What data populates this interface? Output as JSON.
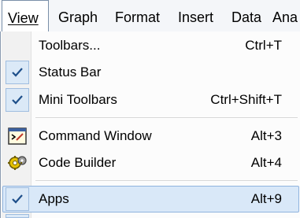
{
  "menubar": {
    "items": [
      {
        "label": "View"
      },
      {
        "label": "Graph"
      },
      {
        "label": "Format"
      },
      {
        "label": "Insert"
      },
      {
        "label": "Data"
      },
      {
        "label": "Ana"
      }
    ]
  },
  "view_menu": {
    "items": [
      {
        "label": "Toolbars...",
        "shortcut": "Ctrl+T",
        "checked": false
      },
      {
        "label": "Status Bar",
        "shortcut": "",
        "checked": true
      },
      {
        "label": "Mini Toolbars",
        "shortcut": "Ctrl+Shift+T",
        "checked": true
      },
      {
        "label": "Command Window",
        "shortcut": "Alt+3",
        "icon": "command-window-icon"
      },
      {
        "label": "Code Builder",
        "shortcut": "Alt+4",
        "icon": "code-builder-icon"
      },
      {
        "label": "Apps",
        "shortcut": "Alt+9",
        "checked": true,
        "highlighted": true
      }
    ]
  },
  "colors": {
    "highlight": "#d9e8f8",
    "check_bg": "#dbe9f7",
    "check_mark": "#1e4f8a"
  }
}
